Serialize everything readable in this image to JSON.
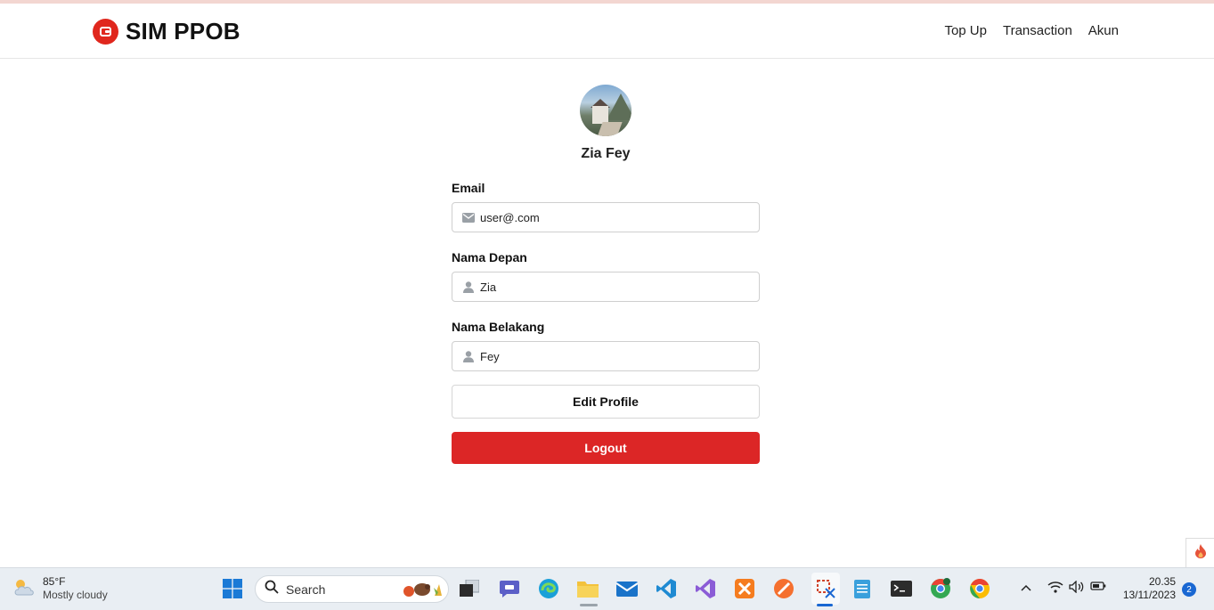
{
  "app": {
    "brand": "SIM PPOB"
  },
  "nav": {
    "items": [
      "Top Up",
      "Transaction",
      "Akun"
    ]
  },
  "profile": {
    "name": "Zia Fey",
    "fields": [
      {
        "label": "Email",
        "value": "user@.com",
        "icon": "envelope-icon"
      },
      {
        "label": "Nama Depan",
        "value": "Zia",
        "icon": "user-icon"
      },
      {
        "label": "Nama Belakang",
        "value": "Fey",
        "icon": "user-icon"
      }
    ],
    "edit_label": "Edit Profile",
    "logout_label": "Logout"
  },
  "colors": {
    "accent": "#dc2626",
    "brand_logo": "#e0271d"
  },
  "taskbar": {
    "weather_temp": "85°F",
    "weather_desc": "Mostly cloudy",
    "search_placeholder": "Search",
    "time": "20.35",
    "date": "13/11/2023",
    "notification_count": "2"
  }
}
